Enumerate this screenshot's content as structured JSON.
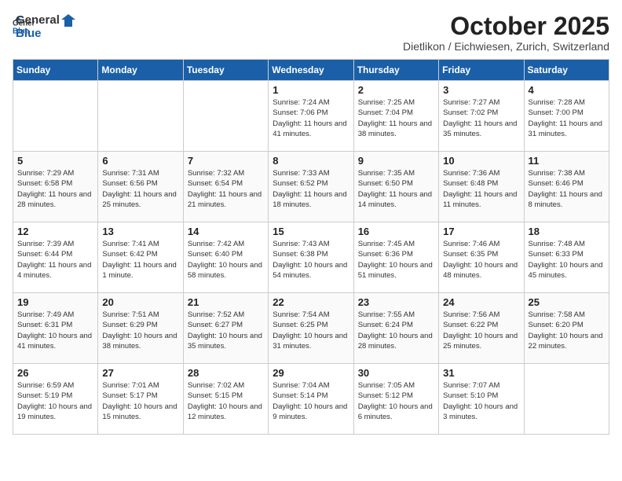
{
  "header": {
    "logo_general": "General",
    "logo_blue": "Blue",
    "month_title": "October 2025",
    "subtitle": "Dietlikon / Eichwiesen, Zurich, Switzerland"
  },
  "weekdays": [
    "Sunday",
    "Monday",
    "Tuesday",
    "Wednesday",
    "Thursday",
    "Friday",
    "Saturday"
  ],
  "weeks": [
    [
      {
        "day": "",
        "sunrise": "",
        "sunset": "",
        "daylight": ""
      },
      {
        "day": "",
        "sunrise": "",
        "sunset": "",
        "daylight": ""
      },
      {
        "day": "",
        "sunrise": "",
        "sunset": "",
        "daylight": ""
      },
      {
        "day": "1",
        "sunrise": "Sunrise: 7:24 AM",
        "sunset": "Sunset: 7:06 PM",
        "daylight": "Daylight: 11 hours and 41 minutes."
      },
      {
        "day": "2",
        "sunrise": "Sunrise: 7:25 AM",
        "sunset": "Sunset: 7:04 PM",
        "daylight": "Daylight: 11 hours and 38 minutes."
      },
      {
        "day": "3",
        "sunrise": "Sunrise: 7:27 AM",
        "sunset": "Sunset: 7:02 PM",
        "daylight": "Daylight: 11 hours and 35 minutes."
      },
      {
        "day": "4",
        "sunrise": "Sunrise: 7:28 AM",
        "sunset": "Sunset: 7:00 PM",
        "daylight": "Daylight: 11 hours and 31 minutes."
      }
    ],
    [
      {
        "day": "5",
        "sunrise": "Sunrise: 7:29 AM",
        "sunset": "Sunset: 6:58 PM",
        "daylight": "Daylight: 11 hours and 28 minutes."
      },
      {
        "day": "6",
        "sunrise": "Sunrise: 7:31 AM",
        "sunset": "Sunset: 6:56 PM",
        "daylight": "Daylight: 11 hours and 25 minutes."
      },
      {
        "day": "7",
        "sunrise": "Sunrise: 7:32 AM",
        "sunset": "Sunset: 6:54 PM",
        "daylight": "Daylight: 11 hours and 21 minutes."
      },
      {
        "day": "8",
        "sunrise": "Sunrise: 7:33 AM",
        "sunset": "Sunset: 6:52 PM",
        "daylight": "Daylight: 11 hours and 18 minutes."
      },
      {
        "day": "9",
        "sunrise": "Sunrise: 7:35 AM",
        "sunset": "Sunset: 6:50 PM",
        "daylight": "Daylight: 11 hours and 14 minutes."
      },
      {
        "day": "10",
        "sunrise": "Sunrise: 7:36 AM",
        "sunset": "Sunset: 6:48 PM",
        "daylight": "Daylight: 11 hours and 11 minutes."
      },
      {
        "day": "11",
        "sunrise": "Sunrise: 7:38 AM",
        "sunset": "Sunset: 6:46 PM",
        "daylight": "Daylight: 11 hours and 8 minutes."
      }
    ],
    [
      {
        "day": "12",
        "sunrise": "Sunrise: 7:39 AM",
        "sunset": "Sunset: 6:44 PM",
        "daylight": "Daylight: 11 hours and 4 minutes."
      },
      {
        "day": "13",
        "sunrise": "Sunrise: 7:41 AM",
        "sunset": "Sunset: 6:42 PM",
        "daylight": "Daylight: 11 hours and 1 minute."
      },
      {
        "day": "14",
        "sunrise": "Sunrise: 7:42 AM",
        "sunset": "Sunset: 6:40 PM",
        "daylight": "Daylight: 10 hours and 58 minutes."
      },
      {
        "day": "15",
        "sunrise": "Sunrise: 7:43 AM",
        "sunset": "Sunset: 6:38 PM",
        "daylight": "Daylight: 10 hours and 54 minutes."
      },
      {
        "day": "16",
        "sunrise": "Sunrise: 7:45 AM",
        "sunset": "Sunset: 6:36 PM",
        "daylight": "Daylight: 10 hours and 51 minutes."
      },
      {
        "day": "17",
        "sunrise": "Sunrise: 7:46 AM",
        "sunset": "Sunset: 6:35 PM",
        "daylight": "Daylight: 10 hours and 48 minutes."
      },
      {
        "day": "18",
        "sunrise": "Sunrise: 7:48 AM",
        "sunset": "Sunset: 6:33 PM",
        "daylight": "Daylight: 10 hours and 45 minutes."
      }
    ],
    [
      {
        "day": "19",
        "sunrise": "Sunrise: 7:49 AM",
        "sunset": "Sunset: 6:31 PM",
        "daylight": "Daylight: 10 hours and 41 minutes."
      },
      {
        "day": "20",
        "sunrise": "Sunrise: 7:51 AM",
        "sunset": "Sunset: 6:29 PM",
        "daylight": "Daylight: 10 hours and 38 minutes."
      },
      {
        "day": "21",
        "sunrise": "Sunrise: 7:52 AM",
        "sunset": "Sunset: 6:27 PM",
        "daylight": "Daylight: 10 hours and 35 minutes."
      },
      {
        "day": "22",
        "sunrise": "Sunrise: 7:54 AM",
        "sunset": "Sunset: 6:25 PM",
        "daylight": "Daylight: 10 hours and 31 minutes."
      },
      {
        "day": "23",
        "sunrise": "Sunrise: 7:55 AM",
        "sunset": "Sunset: 6:24 PM",
        "daylight": "Daylight: 10 hours and 28 minutes."
      },
      {
        "day": "24",
        "sunrise": "Sunrise: 7:56 AM",
        "sunset": "Sunset: 6:22 PM",
        "daylight": "Daylight: 10 hours and 25 minutes."
      },
      {
        "day": "25",
        "sunrise": "Sunrise: 7:58 AM",
        "sunset": "Sunset: 6:20 PM",
        "daylight": "Daylight: 10 hours and 22 minutes."
      }
    ],
    [
      {
        "day": "26",
        "sunrise": "Sunrise: 6:59 AM",
        "sunset": "Sunset: 5:19 PM",
        "daylight": "Daylight: 10 hours and 19 minutes."
      },
      {
        "day": "27",
        "sunrise": "Sunrise: 7:01 AM",
        "sunset": "Sunset: 5:17 PM",
        "daylight": "Daylight: 10 hours and 15 minutes."
      },
      {
        "day": "28",
        "sunrise": "Sunrise: 7:02 AM",
        "sunset": "Sunset: 5:15 PM",
        "daylight": "Daylight: 10 hours and 12 minutes."
      },
      {
        "day": "29",
        "sunrise": "Sunrise: 7:04 AM",
        "sunset": "Sunset: 5:14 PM",
        "daylight": "Daylight: 10 hours and 9 minutes."
      },
      {
        "day": "30",
        "sunrise": "Sunrise: 7:05 AM",
        "sunset": "Sunset: 5:12 PM",
        "daylight": "Daylight: 10 hours and 6 minutes."
      },
      {
        "day": "31",
        "sunrise": "Sunrise: 7:07 AM",
        "sunset": "Sunset: 5:10 PM",
        "daylight": "Daylight: 10 hours and 3 minutes."
      },
      {
        "day": "",
        "sunrise": "",
        "sunset": "",
        "daylight": ""
      }
    ]
  ]
}
